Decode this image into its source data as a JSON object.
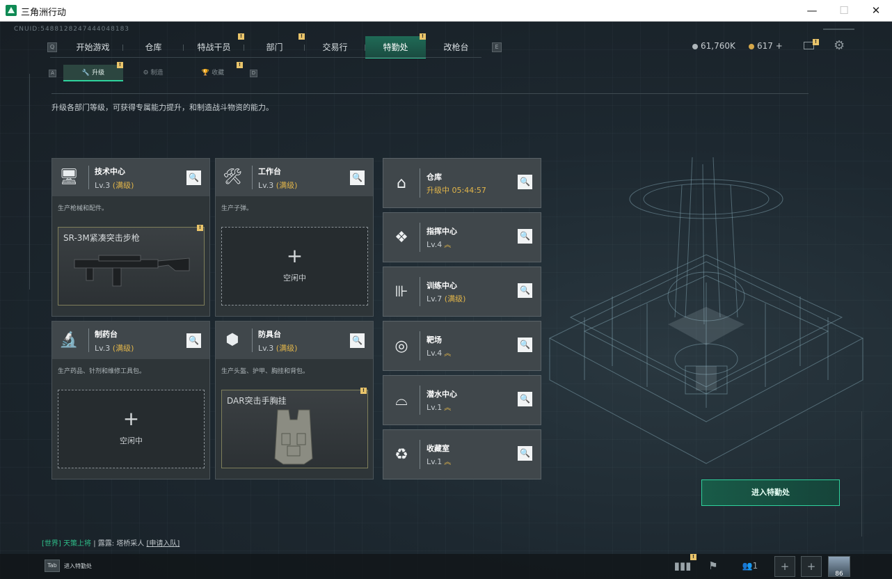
{
  "window": {
    "title": "三角洲行动",
    "minimize": "—",
    "maximize": "☐",
    "close": "✕"
  },
  "uid": "CNUID:5488128247444048183",
  "main_nav": {
    "left_key": "Q",
    "right_key": "E",
    "tabs": [
      {
        "label": "开始游戏",
        "badge": "",
        "active": false
      },
      {
        "label": "仓库",
        "badge": "",
        "active": false
      },
      {
        "label": "特战干员",
        "badge": "!",
        "active": false
      },
      {
        "label": "部门",
        "badge": "!",
        "active": false
      },
      {
        "label": "交易行",
        "badge": "",
        "active": false
      },
      {
        "label": "特勤处",
        "badge": "!",
        "active": true
      },
      {
        "label": "改枪台",
        "badge": "",
        "active": false
      }
    ]
  },
  "currency": {
    "coins": "61,760K",
    "tokens": "617",
    "plus": "+",
    "mail_badge": "!"
  },
  "sub_nav": {
    "left_key": "A",
    "right_key": "D",
    "tabs": [
      {
        "label": "升级",
        "icon": "🔧",
        "badge": "!",
        "active": true
      },
      {
        "label": "制造",
        "icon": "⚙",
        "badge": "",
        "active": false
      },
      {
        "label": "收藏",
        "icon": "🏆",
        "badge": "!",
        "active": false
      }
    ]
  },
  "description": "升级各部门等级，可获得专属能力提升，和制造战斗物资的能力。",
  "workshops": [
    {
      "title": "技术中心",
      "level": "Lv.3",
      "status": "(满级)",
      "icon": "computer-icon",
      "glyph": "🖥",
      "desc": "生产枪械和配件。",
      "slot_state": "filled",
      "slot_name": "SR-3M紧凑突击步枪",
      "slot_badge": "!"
    },
    {
      "title": "工作台",
      "level": "Lv.3",
      "status": "(满级)",
      "icon": "tools-icon",
      "glyph": "🛠",
      "desc": "生产子弹。",
      "slot_state": "idle",
      "slot_name": "空闲中",
      "slot_badge": ""
    },
    {
      "title": "制药台",
      "level": "Lv.3",
      "status": "(满级)",
      "icon": "microscope-icon",
      "glyph": "🔬",
      "desc": "生产药品、针剂和维修工具包。",
      "slot_state": "idle",
      "slot_name": "空闲中",
      "slot_badge": ""
    },
    {
      "title": "防具台",
      "level": "Lv.3",
      "status": "(满级)",
      "icon": "armor-blocks-icon",
      "glyph": "⬢",
      "desc": "生产头盔、护甲、胸挂和背包。",
      "slot_state": "filled",
      "slot_name": "DAR突击手胸挂",
      "slot_badge": "!"
    }
  ],
  "facilities": [
    {
      "title": "仓库",
      "level": "升级中 05:44:57",
      "upgrading": true,
      "icon": "warehouse-icon",
      "glyph": "⌂",
      "up": ""
    },
    {
      "title": "指挥中心",
      "level": "Lv.4",
      "upgrading": false,
      "icon": "command-center-icon",
      "glyph": "❖",
      "up": "︽"
    },
    {
      "title": "训练中心",
      "level": "Lv.7",
      "status": "(满级)",
      "upgrading": false,
      "icon": "dumbbell-icon",
      "glyph": "⊪",
      "up": ""
    },
    {
      "title": "靶场",
      "level": "Lv.4",
      "upgrading": false,
      "icon": "target-icon",
      "glyph": "◎",
      "up": "︽"
    },
    {
      "title": "潜水中心",
      "level": "Lv.1",
      "upgrading": false,
      "icon": "dive-mask-icon",
      "glyph": "⌓",
      "up": "︽"
    },
    {
      "title": "收藏室",
      "level": "Lv.1",
      "upgrading": false,
      "icon": "collection-icon",
      "glyph": "♻",
      "up": "︽"
    }
  ],
  "plus_glyph": "+",
  "search_glyph": "🔍",
  "enter_button": "进入特勤处",
  "chat": {
    "channel": "[世界]",
    "sender": "天策上将",
    "sep": "|",
    "user": "露露",
    "message": "塔桥采人",
    "apply": "[申请入队]"
  },
  "bottom": {
    "tab_key": "Tab",
    "tab_label": "进入特勤处",
    "stats_badge": "!",
    "friends_count": "1",
    "avatar_level": "86"
  },
  "colors": {
    "accent": "#2fd39d",
    "gold": "#e1b54a",
    "badge": "#e9c46a"
  }
}
